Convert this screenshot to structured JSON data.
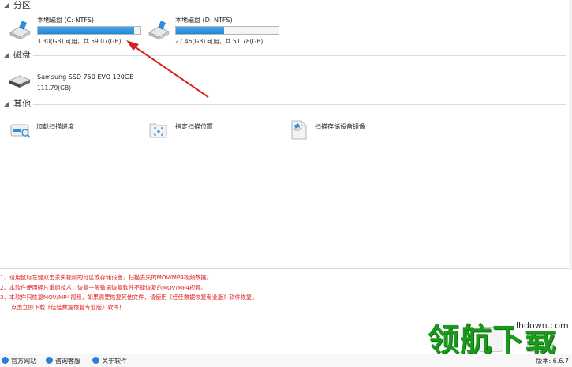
{
  "sections": {
    "partition": "分区",
    "disk": "磁盘",
    "other": "其他"
  },
  "drives": [
    {
      "name": "本地磁盘 (C: NTFS)",
      "stats": "3.30(GB) 可用，共 59.07(GB)",
      "used_fraction": 0.94
    },
    {
      "name": "本地磁盘 (D: NTFS)",
      "stats": "27.46(GB) 可用，共 51.78(GB)",
      "used_fraction": 0.47
    }
  ],
  "disk": {
    "name": "Samsung SSD 750 EVO 120GB",
    "size": "111.79(GB)"
  },
  "tools": [
    {
      "label": "加载扫描进度",
      "icon": "load-progress-icon"
    },
    {
      "label": "指定扫描位置",
      "icon": "scan-location-icon"
    },
    {
      "label": "扫描存储设备镜像",
      "icon": "device-image-icon"
    }
  ],
  "notes": [
    "1、请用鼠标左键双击丢失视频的分区或存储设备，扫描丢失的MOV/MP4视频数据。",
    "2、本软件使用碎片重组技术，恢复一般数据恢复软件不能恢复的MOV/MP4视频。",
    "3、本软件只恢复MOV/MP4视频，如果需要恢复其他文件，请使用《佳佳数据恢复专业版》软件恢复。",
    "点击立即下载《佳佳数据恢复专业版》软件！"
  ],
  "statusbar": {
    "website": "官方网站",
    "support": "咨询客服",
    "about": "关于软件",
    "version": "版本: 6.6.7"
  },
  "watermark": {
    "text": "领航下载",
    "url": "lhdown.com"
  },
  "colors": {
    "bar_fill": "#1f88d8",
    "notes": "#e02020",
    "annotation_arrow": "#d42222",
    "watermark": "#1a9a1a"
  }
}
